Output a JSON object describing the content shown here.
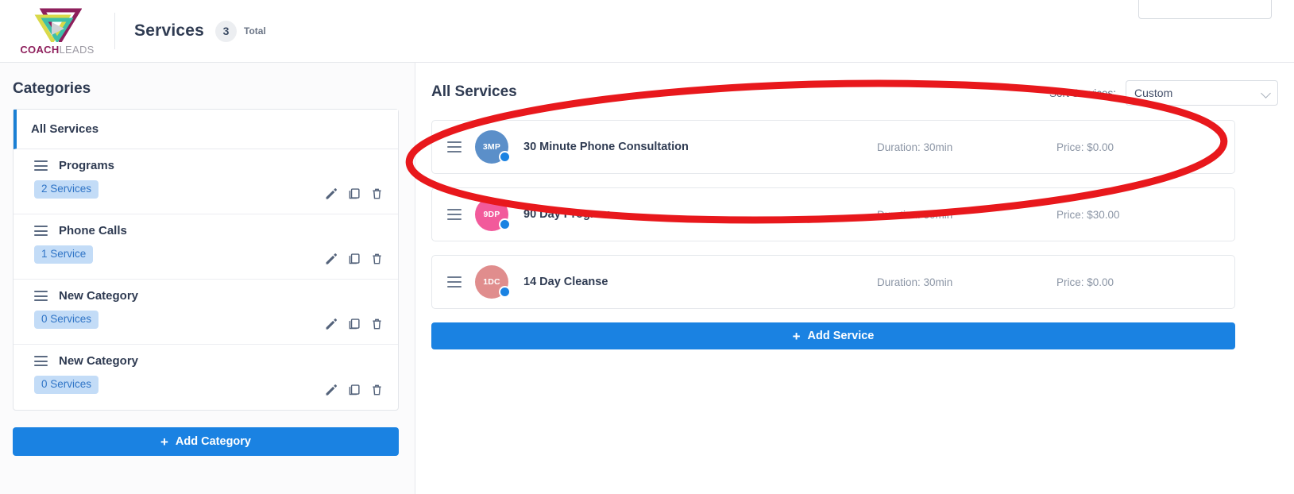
{
  "header": {
    "logo_primary": "COACH",
    "logo_secondary": "LEADS",
    "title": "Services",
    "count": "3",
    "count_label": "Total"
  },
  "sidebar": {
    "title": "Categories",
    "all_services_label": "All Services",
    "categories": [
      {
        "name": "Programs",
        "count_label": "2 Services"
      },
      {
        "name": "Phone Calls",
        "count_label": "1 Service"
      },
      {
        "name": "New Category",
        "count_label": "0 Services"
      },
      {
        "name": "New Category",
        "count_label": "0 Services"
      }
    ],
    "add_category_label": "Add Category",
    "plus": "+"
  },
  "main": {
    "title": "All Services",
    "sort_label": "Sort Services:",
    "sort_value": "Custom",
    "sort_options": [
      "Custom"
    ],
    "add_service_label": "Add Service",
    "plus": "+",
    "services": [
      {
        "initials": "3MP",
        "name": "30 Minute Phone Consultation",
        "duration": "Duration: 30min",
        "price": "Price: $0.00",
        "color": "#5b8fc9"
      },
      {
        "initials": "9DP",
        "name": "90 Day Program",
        "duration": "Duration: 30min",
        "price": "Price: $30.00",
        "color": "#f25a9b"
      },
      {
        "initials": "1DC",
        "name": "14 Day Cleanse",
        "duration": "Duration: 30min",
        "price": "Price: $0.00",
        "color": "#e08d8d"
      }
    ]
  },
  "colors": {
    "accent_blue": "#1a82e2",
    "annotation_red": "#e8181c",
    "pill_bg": "#c3dcf7",
    "text_dark": "#2f3b52"
  }
}
